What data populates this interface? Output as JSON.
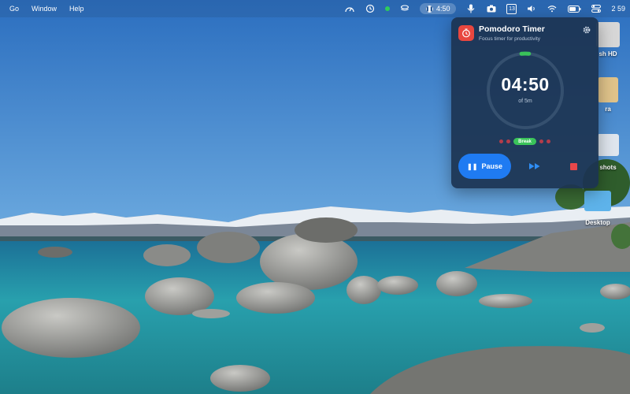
{
  "menubar": {
    "menus": [
      "Go",
      "Window",
      "Help"
    ],
    "timer_label": "4:50",
    "calendar_day": "13",
    "clock": "2 59"
  },
  "desktop": {
    "icons": [
      {
        "label": "sh HD"
      },
      {
        "label": "ra"
      },
      {
        "label": "shots"
      },
      {
        "label": "Desktop"
      }
    ]
  },
  "popover": {
    "title": "Pomodoro Timer",
    "subtitle": "Focus timer for productivity",
    "time": "04:50",
    "duration": "of 5m",
    "progress_fraction": 0.033,
    "phase_badge": "Break",
    "pause_label": "Pause"
  },
  "colors": {
    "accent": "#1f7bf2",
    "break_green": "#3ac35a",
    "app_red": "#e8473f",
    "stop_red": "#e8474a",
    "panel": "#1c3452"
  },
  "icons": {
    "app": "timer-icon",
    "settings": "gear-icon",
    "pause": "pause-icon",
    "skip": "fast-forward-icon",
    "stop": "stop-icon"
  }
}
